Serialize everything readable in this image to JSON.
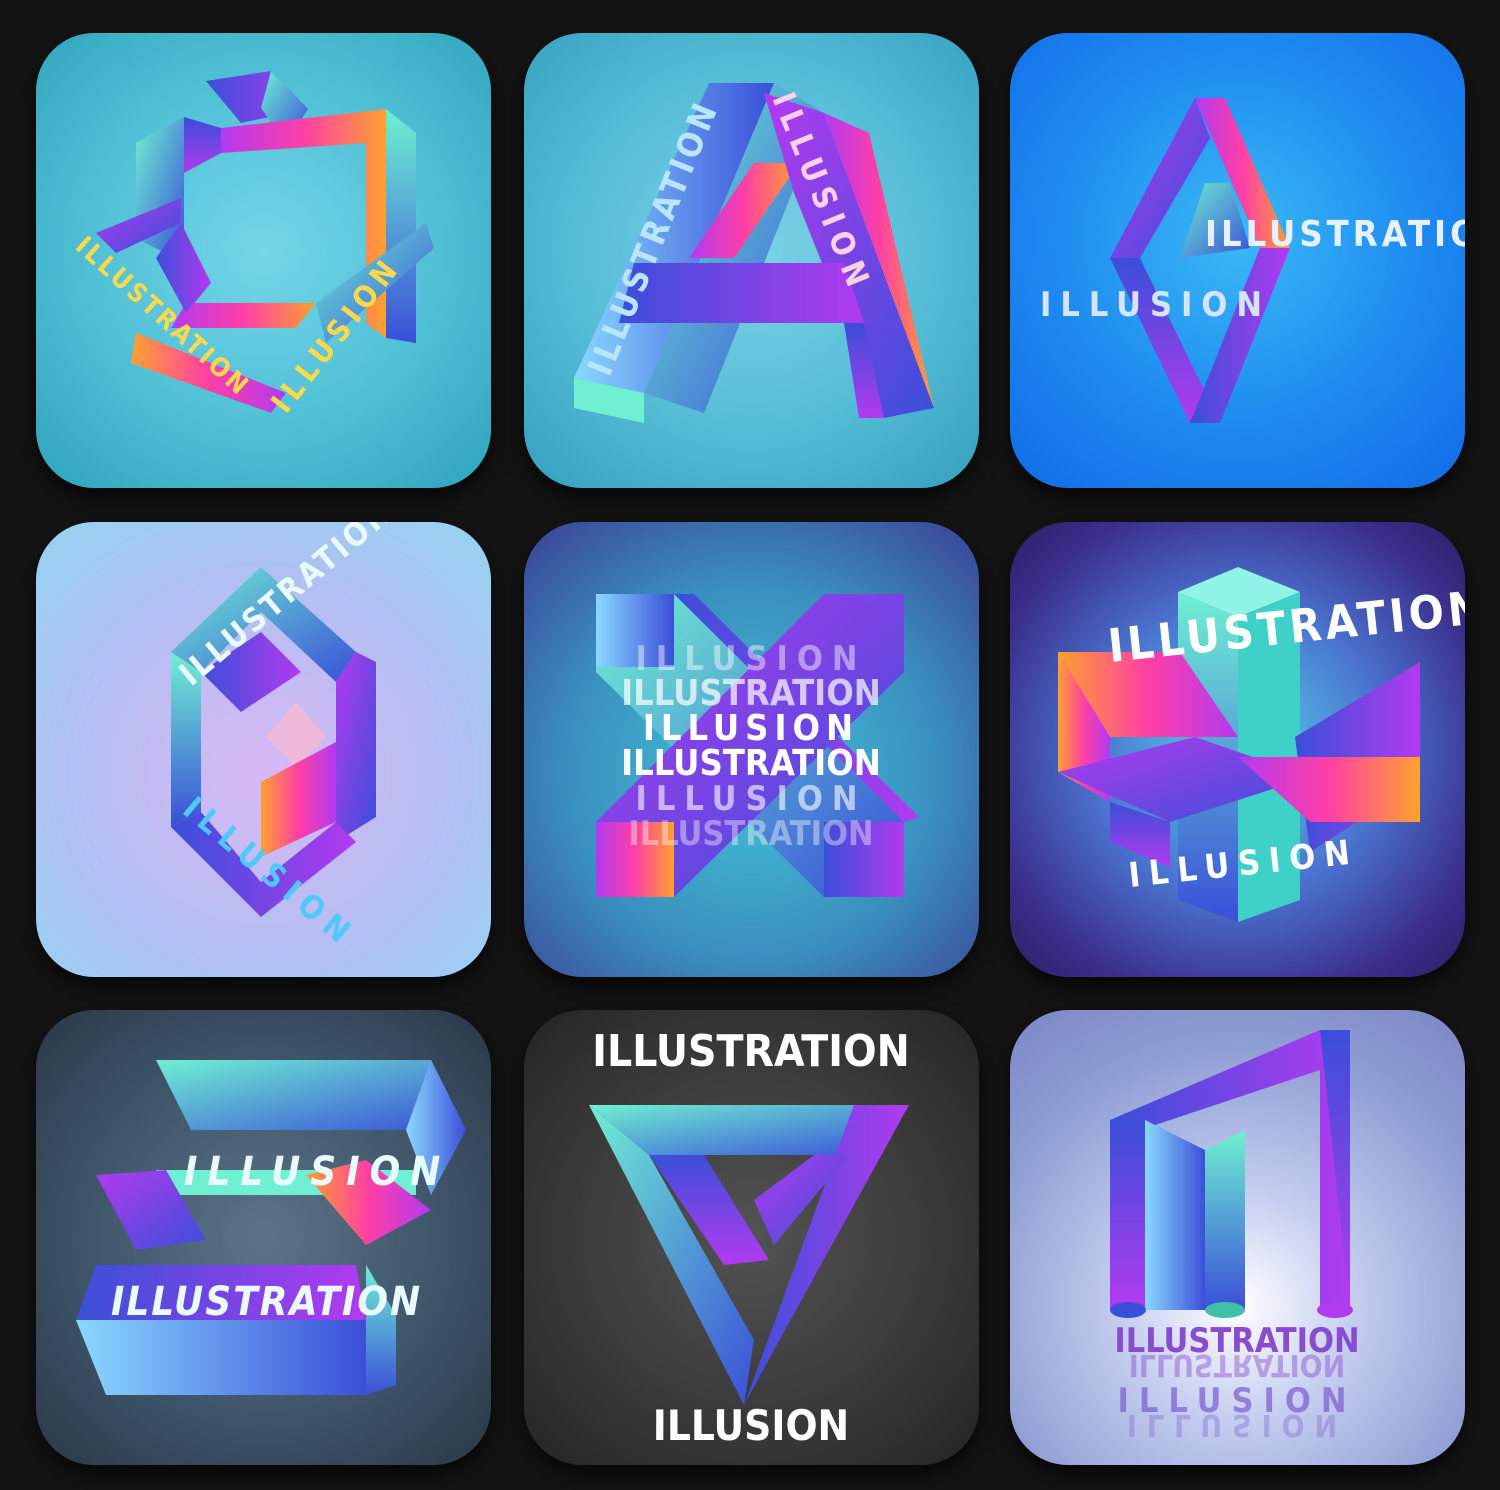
{
  "tiles": [
    {
      "id": "t1",
      "texts": [
        "ILLUSTRATION",
        "ILLUSION"
      ]
    },
    {
      "id": "t2",
      "texts": [
        "ILLUSTRATION",
        "ILLUSION"
      ]
    },
    {
      "id": "t3",
      "texts": [
        "ILLUSTRATION",
        "ILLUSION"
      ]
    },
    {
      "id": "t4",
      "texts": [
        "ILLUSTRATION",
        "ILLUSION"
      ]
    },
    {
      "id": "t5",
      "texts": [
        "ILLUSION",
        "ILLUSTRATION",
        "ILLUSION",
        "ILLUSTRATION",
        "ILLUSION",
        "ILLUSTRATION"
      ]
    },
    {
      "id": "t6",
      "texts": [
        "ILLUSTRATION",
        "ILLUSION"
      ]
    },
    {
      "id": "t7",
      "texts": [
        "ILLUSION",
        "ILLUSTRATION"
      ]
    },
    {
      "id": "t8",
      "texts": [
        "ILLUSTRATION",
        "ILLUSION"
      ]
    },
    {
      "id": "t9",
      "texts": [
        "ILLUSTRATION",
        "ILLUSTRATION",
        "ILLUSION",
        "ILLUSION"
      ]
    }
  ],
  "colors": {
    "page_background": "#141414",
    "gradient_cyan": "#6ff0d2",
    "gradient_blue": "#3a4fd8",
    "gradient_purple": "#b23af0",
    "gradient_magenta": "#ff3fa6",
    "gradient_orange": "#ffa12e",
    "text_yellow": "#ffd94a",
    "text_white": "#ffffff"
  }
}
